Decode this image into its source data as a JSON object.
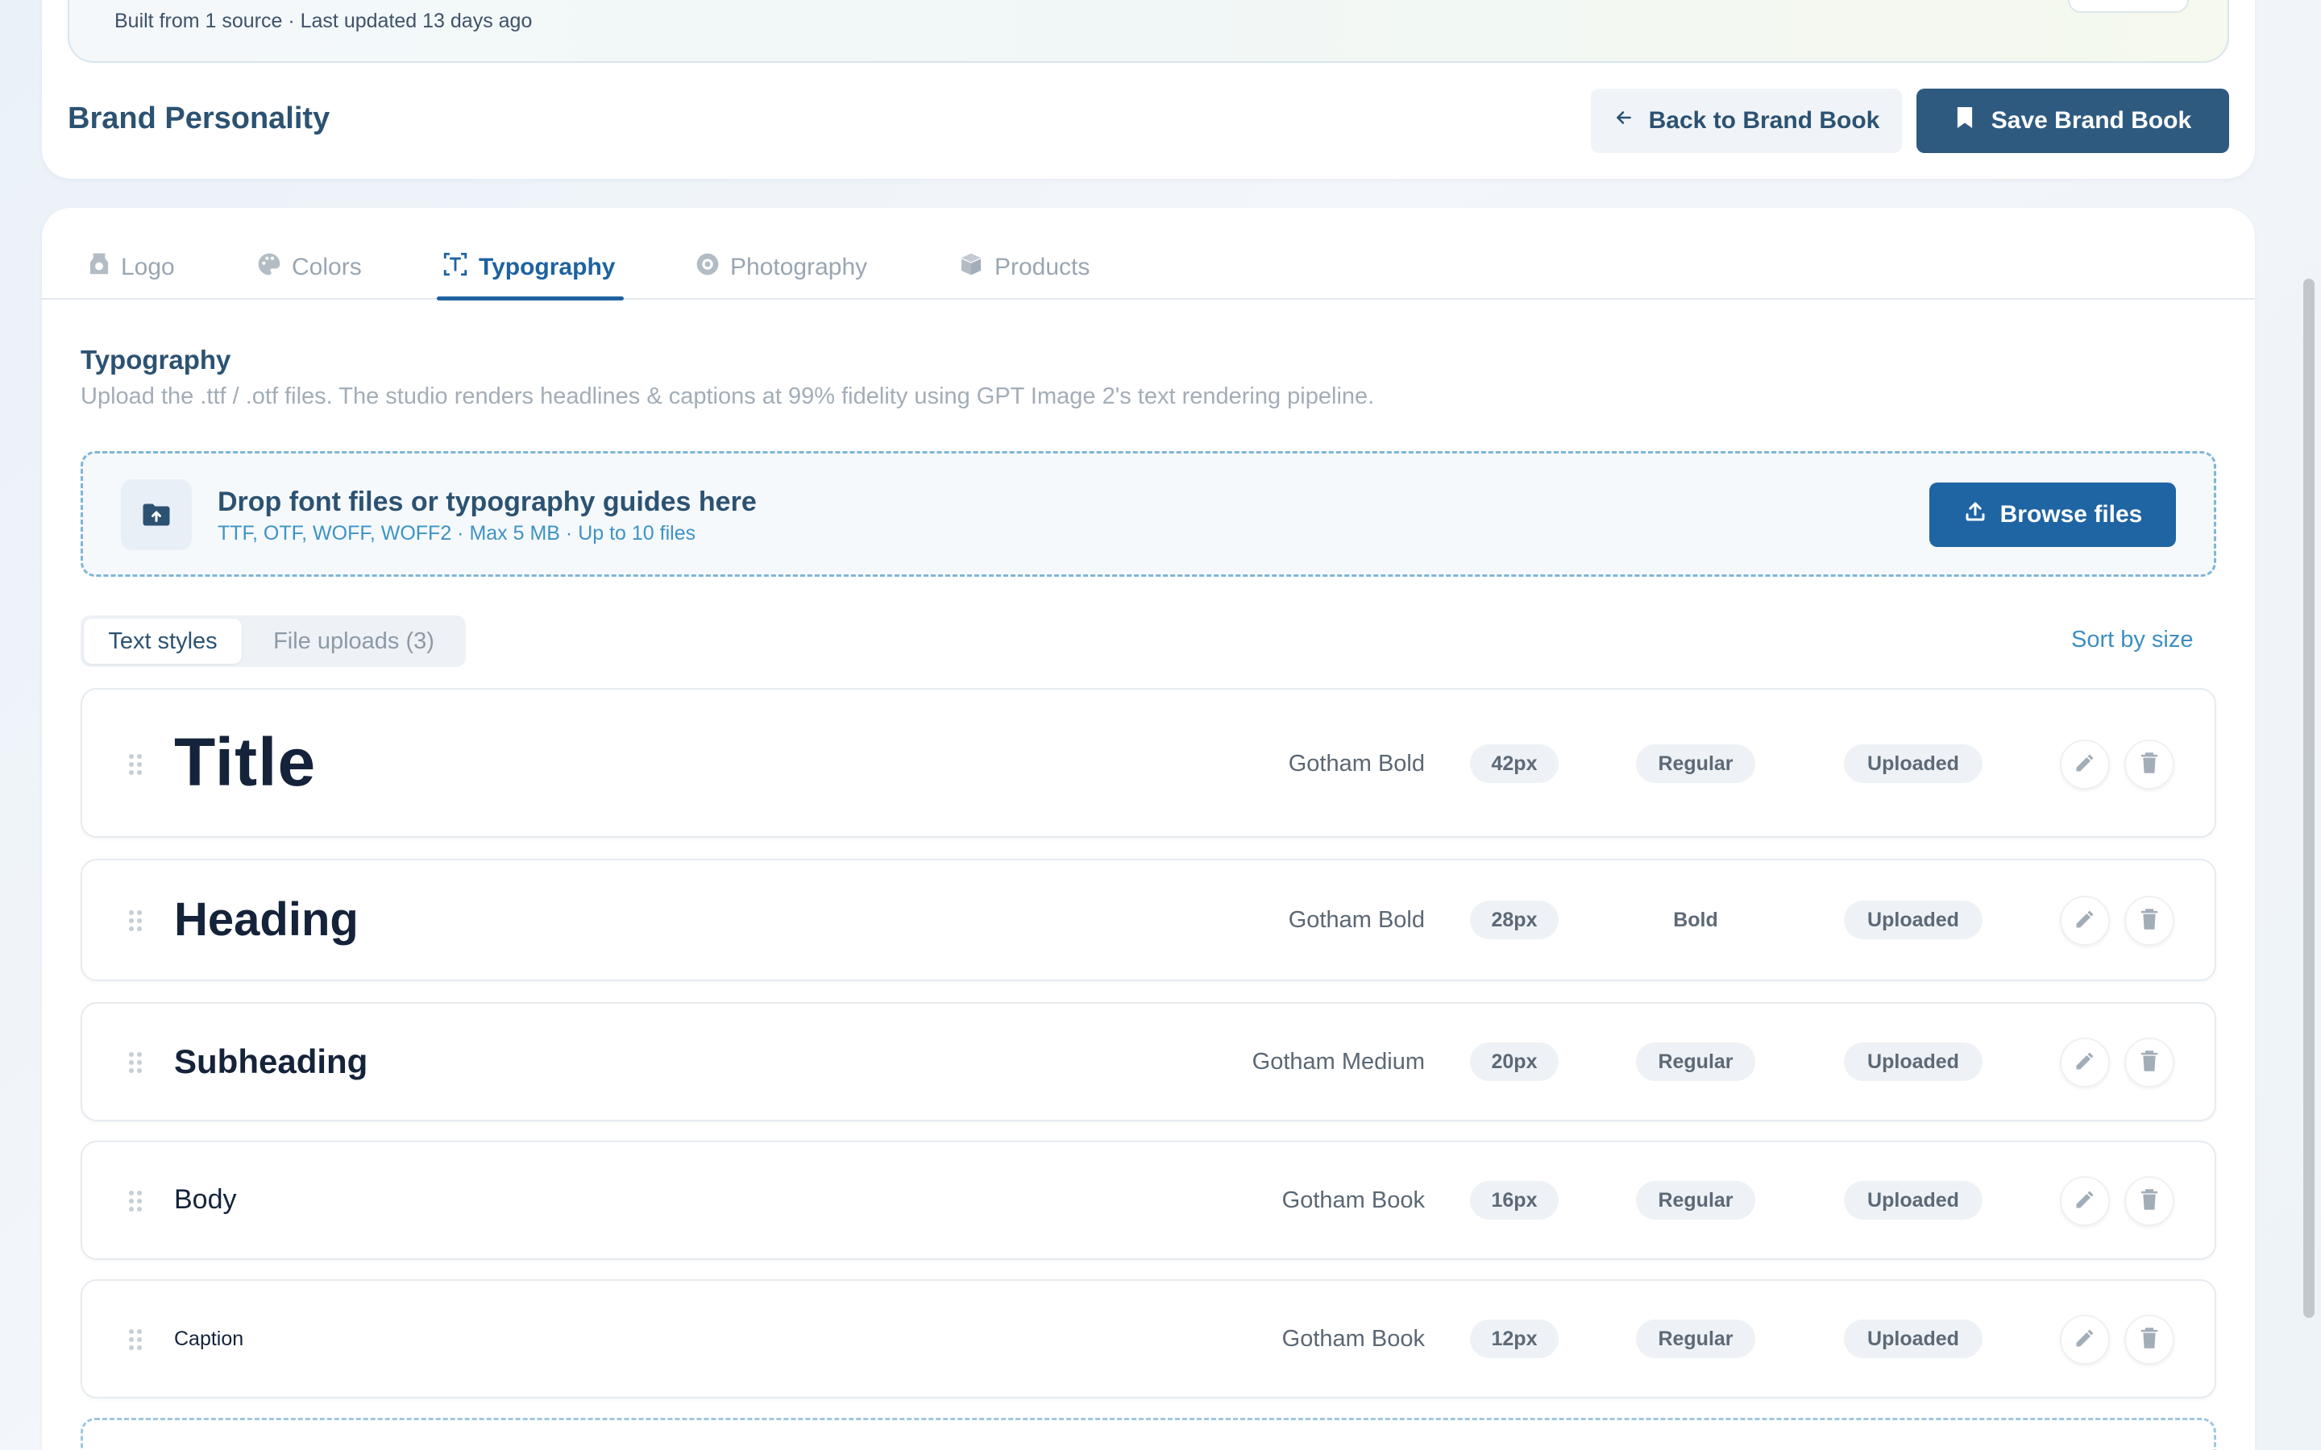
{
  "header": {
    "meta": "Built from 1 source · Last updated 13 days ago",
    "section_title": "Brand Personality",
    "back_label": "Back to Brand Book",
    "save_label": "Save Brand Book"
  },
  "tabs": [
    {
      "label": "Logo",
      "icon": "logo-icon"
    },
    {
      "label": "Colors",
      "icon": "palette-icon"
    },
    {
      "label": "Typography",
      "icon": "typography-icon",
      "active": true
    },
    {
      "label": "Photography",
      "icon": "camera-icon"
    },
    {
      "label": "Products",
      "icon": "box-icon"
    }
  ],
  "typography": {
    "title": "Typography",
    "description": "Upload the .ttf / .otf files. The studio renders headlines & captions at 99% fidelity using GPT Image 2's text rendering pipeline."
  },
  "dropzone": {
    "title": "Drop font files or typography guides here",
    "subtitle": "TTF, OTF, WOFF, WOFF2 · Max 5 MB · Up to 10 files",
    "browse_label": "Browse files"
  },
  "subtabs": {
    "text_styles": "Text styles",
    "file_uploads": "File uploads (3)",
    "sort_label": "Sort by size"
  },
  "styles": [
    {
      "name": "Title",
      "font": "Gotham Bold",
      "size": "42px",
      "weight": "Regular",
      "status": "Uploaded"
    },
    {
      "name": "Heading",
      "font": "Gotham Bold",
      "size": "28px",
      "weight": "Bold",
      "status": "Uploaded"
    },
    {
      "name": "Subheading",
      "font": "Gotham Medium",
      "size": "20px",
      "weight": "Regular",
      "status": "Uploaded"
    },
    {
      "name": "Body",
      "font": "Gotham Book",
      "size": "16px",
      "weight": "Regular",
      "status": "Uploaded"
    },
    {
      "name": "Caption",
      "font": "Gotham Book",
      "size": "12px",
      "weight": "Regular",
      "status": "Uploaded"
    }
  ],
  "colors": {
    "primary": "#1f64a3",
    "save_button": "#2f5a80",
    "heading_text": "#2c5272",
    "accent_link": "#3d8fc0"
  }
}
